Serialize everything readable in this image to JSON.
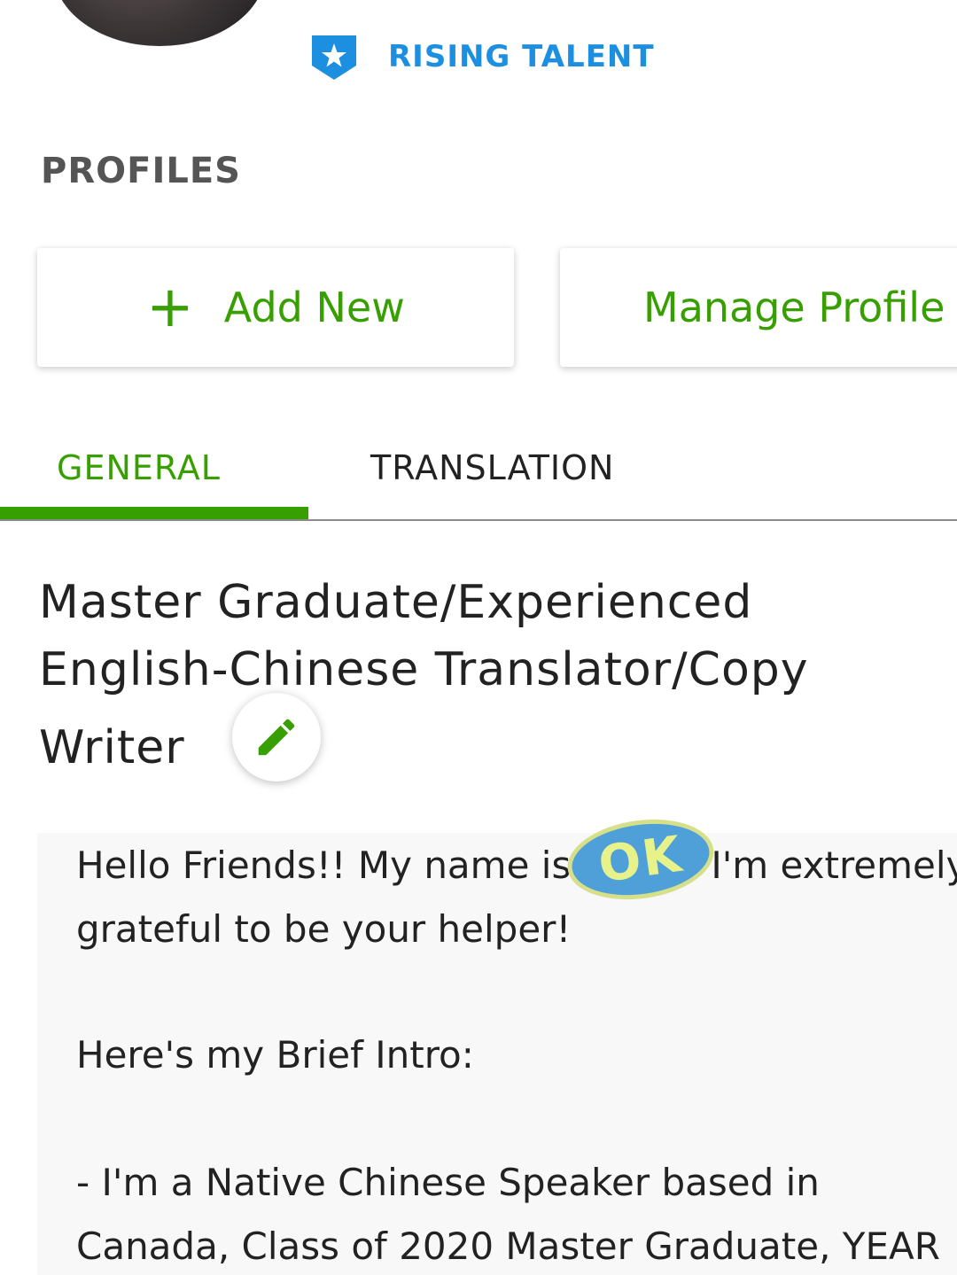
{
  "header": {
    "badge_label": "RISING TALENT"
  },
  "profiles": {
    "section_title": "PROFILES",
    "add_new_label": "Add New",
    "manage_label": "Manage Profile"
  },
  "tabs": [
    {
      "label": "GENERAL",
      "active": true
    },
    {
      "label": "TRANSLATION",
      "active": false
    }
  ],
  "profile_title": {
    "line1": "Master Graduate/Experienced",
    "line2": "English-Chinese Translator/Copy",
    "line3": "Writer"
  },
  "overview": {
    "line1_before": "Hello Friends!! My name is",
    "line1_after": "I'm extremely",
    "line2": "grateful to be your helper!",
    "line3": "Here's my Brief Intro:",
    "line4": "- I'm a Native Chinese Speaker based in",
    "line5": "Canada, Class of 2020 Master Graduate, YEAR"
  },
  "stamp": {
    "text": "OK"
  },
  "colors": {
    "accent_green": "#37a000",
    "badge_blue": "#1d8fe0"
  }
}
